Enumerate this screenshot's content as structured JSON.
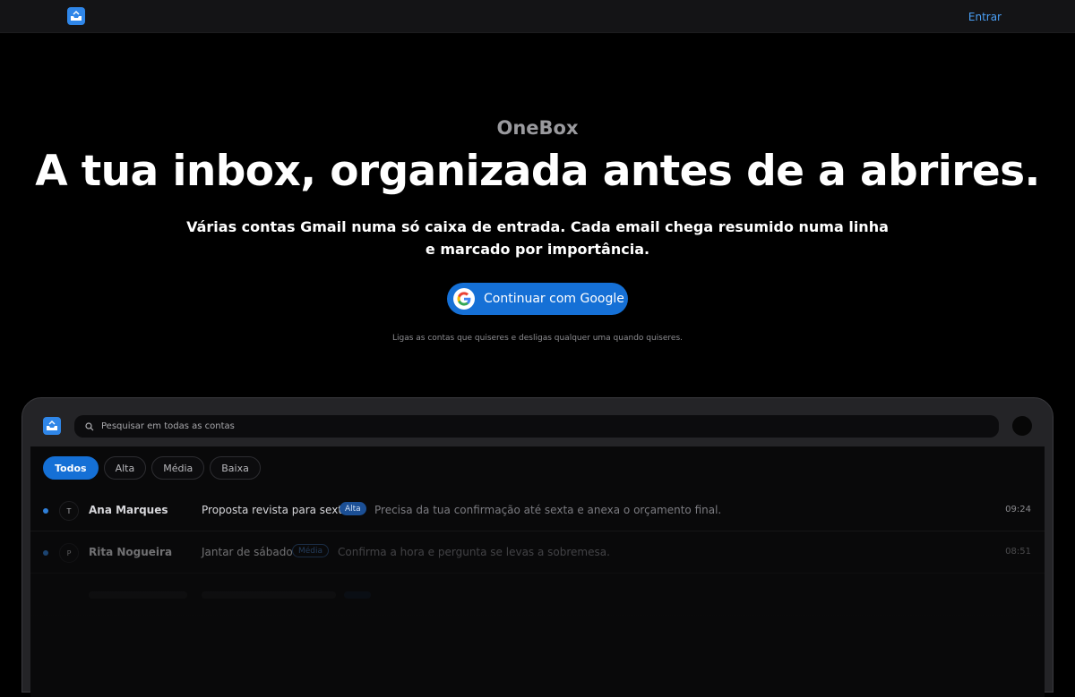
{
  "topbar": {
    "signin_label": "Entrar",
    "logo_icon": "inbox-logo-icon"
  },
  "hero": {
    "brand": "OneBox",
    "headline": "A tua inbox, organizada antes de a abrires.",
    "subtitle_line1": "Várias contas Gmail numa só caixa de entrada. Cada email chega resumido numa linha",
    "subtitle_line2": "e marcado por importância.",
    "cta_label": "Continuar com Google",
    "fineprint": "Ligas as contas que quiseres e desligas qualquer uma quando quiseres."
  },
  "preview_app": {
    "search_placeholder": "Pesquisar em todas as contas",
    "filters": [
      "Todos",
      "Alta",
      "Média",
      "Baixa"
    ],
    "active_filter": "Todos",
    "emails": [
      {
        "initial": "T",
        "sender": "Ana Marques",
        "subject": "Proposta revista para sexta",
        "priority": "Alta",
        "preview": "Precisa da tua confirmação até sexta e anexa o orçamento final.",
        "time": "09:24"
      },
      {
        "initial": "P",
        "sender": "Rita Nogueira",
        "subject": "Jantar de sábado",
        "priority": "Média",
        "preview": "Confirma a hora e pergunta se levas a sobremesa.",
        "time": "08:51"
      }
    ]
  },
  "colors": {
    "accent": "#1570d6",
    "link": "#4a9ff5",
    "background": "#000000",
    "topbar": "#141416"
  }
}
